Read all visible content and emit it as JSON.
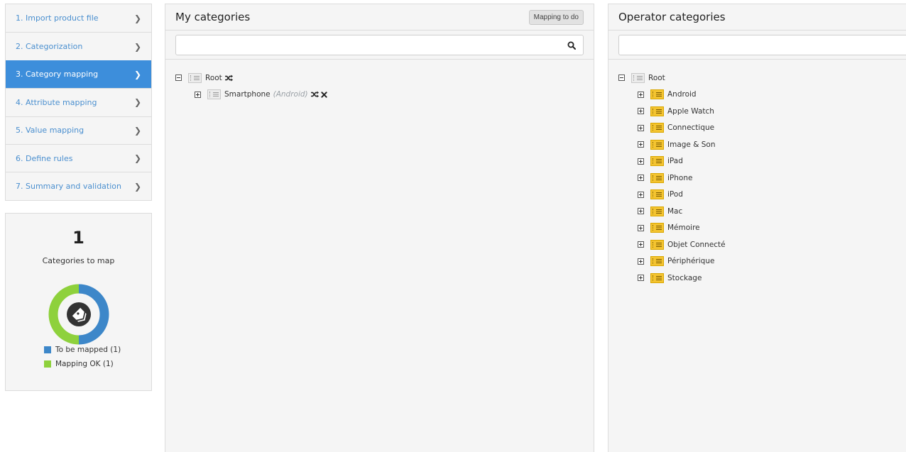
{
  "steps": [
    {
      "label": "1. Import product file",
      "active": false
    },
    {
      "label": "2. Categorization",
      "active": false
    },
    {
      "label": "3. Category mapping",
      "active": true
    },
    {
      "label": "4. Attribute mapping",
      "active": false
    },
    {
      "label": "5. Value mapping",
      "active": false
    },
    {
      "label": "6. Define rules",
      "active": false
    },
    {
      "label": "7. Summary and validation",
      "active": false
    }
  ],
  "stats": {
    "count": "1",
    "label": "Categories to map",
    "chart_data": {
      "type": "pie",
      "categories": [
        "To be mapped (1)",
        "Mapping OK (1)"
      ],
      "values": [
        1,
        1
      ],
      "colors": [
        "#3d87c9",
        "#8ed13c"
      ]
    },
    "legend": [
      {
        "label": "To be mapped (1)",
        "color": "#3d87c9"
      },
      {
        "label": "Mapping OK (1)",
        "color": "#8ed13c"
      }
    ],
    "center_icon": "tags-icon"
  },
  "my_categories": {
    "title": "My categories",
    "mapping_button": "Mapping to do",
    "search_placeholder": "",
    "root": {
      "label": "Root"
    },
    "children": [
      {
        "label": "Smartphone",
        "hint": "(Android)"
      }
    ]
  },
  "operator_categories": {
    "title": "Operator categories",
    "search_placeholder": "",
    "root": {
      "label": "Root"
    },
    "children": [
      {
        "label": "Android"
      },
      {
        "label": "Apple Watch"
      },
      {
        "label": "Connectique"
      },
      {
        "label": "Image & Son"
      },
      {
        "label": "iPad"
      },
      {
        "label": "iPhone"
      },
      {
        "label": "iPod"
      },
      {
        "label": "Mac"
      },
      {
        "label": "Mémoire"
      },
      {
        "label": "Objet Connecté"
      },
      {
        "label": "Périphérique"
      },
      {
        "label": "Stockage"
      }
    ]
  },
  "icons": {
    "step_chevron": "chevron-right-icon",
    "search": "search-icon",
    "shuffle": "shuffle-icon",
    "remove": "close-icon",
    "folder": "category-folder-icon"
  }
}
